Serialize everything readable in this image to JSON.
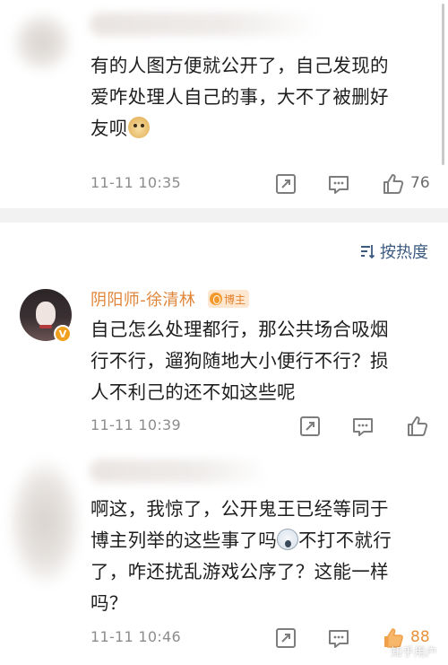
{
  "comments": [
    {
      "text_lines": [
        "有的人图方便就公开了，自己发现的",
        "爱咋处理人自己的事，大不了被删好",
        "友呗"
      ],
      "emoji": "doge",
      "time": "11-11 10:35",
      "likes": "76"
    },
    {
      "username": "阴阳师-徐清林",
      "badge": "博主",
      "text_lines": [
        "自己怎么处理都行，那公共场合吸烟",
        "行不行，遛狗随地大小便行不行？损",
        "人不利己的还不如这些呢"
      ],
      "time": "11-11 10:39",
      "likes": ""
    },
    {
      "text_lines": [
        "啊这，我惊了，公开鬼王已经等同于",
        "博主列举的这些事了吗",
        "不打不就行",
        "了，咋还扰乱游戏公序了？这能一样",
        "吗？"
      ],
      "emoji": "shocked",
      "time": "11-11 10:46",
      "likes": "88"
    }
  ],
  "sort_label": "按热度",
  "watermark": "知乎用户",
  "colors": {
    "username": "#e0863a",
    "sort": "#3c5a80",
    "like_active": "#f0a04a"
  },
  "icons": [
    "share-icon",
    "reply-icon",
    "like-icon",
    "sort-icon",
    "v-badge-icon"
  ]
}
